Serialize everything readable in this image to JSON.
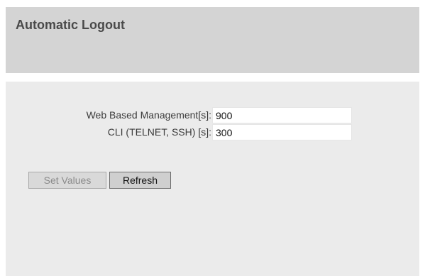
{
  "page": {
    "title": "Automatic Logout"
  },
  "form": {
    "fields": [
      {
        "label": "Web Based Management[s]:",
        "value": "900"
      },
      {
        "label": "CLI (TELNET, SSH) [s]:",
        "value": "300"
      }
    ]
  },
  "buttons": {
    "set_values": {
      "label": "Set Values",
      "enabled": false
    },
    "refresh": {
      "label": "Refresh",
      "enabled": true
    }
  },
  "colors": {
    "header_bg": "#d4d4d4",
    "content_bg": "#ebebeb",
    "title_text": "#4a4a4a"
  }
}
